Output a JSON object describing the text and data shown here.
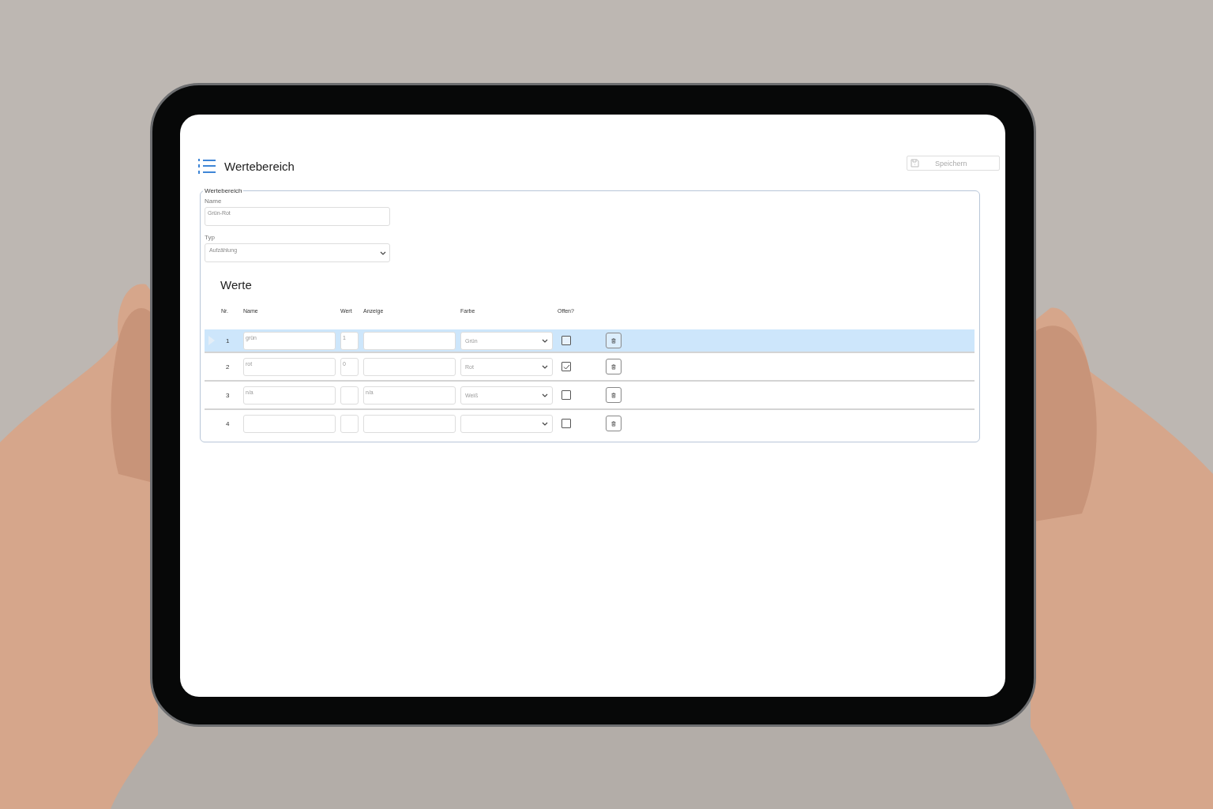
{
  "page": {
    "title": "Wertebereich",
    "save_button": {
      "label": "Speichern",
      "disabled": true
    }
  },
  "fieldset": {
    "legend": "Wertebereich",
    "fields": [
      {
        "label": "Name",
        "kind": "text",
        "value": "Grün-Rot"
      },
      {
        "label": "Typ",
        "kind": "select",
        "value": "Aufzählung"
      }
    ]
  },
  "values_section": {
    "title": "Werte",
    "columns": [
      "Nr.",
      "Name",
      "Wert",
      "Anzeige",
      "Farbe",
      "Offen?"
    ],
    "rows": [
      {
        "nr": "1",
        "name": "grün",
        "wert": "1",
        "farbe": "Grün",
        "offen": false,
        "selected": true
      },
      {
        "nr": "2",
        "name": "rot",
        "wert": "0",
        "farbe": "Rot",
        "offen": true,
        "selected": false
      },
      {
        "nr": "3",
        "name": "n/a",
        "anzeige": "n/a",
        "farbe": "Weiß",
        "offen": false,
        "selected": false
      },
      {
        "nr": "4",
        "offen": false,
        "selected": false
      }
    ]
  }
}
